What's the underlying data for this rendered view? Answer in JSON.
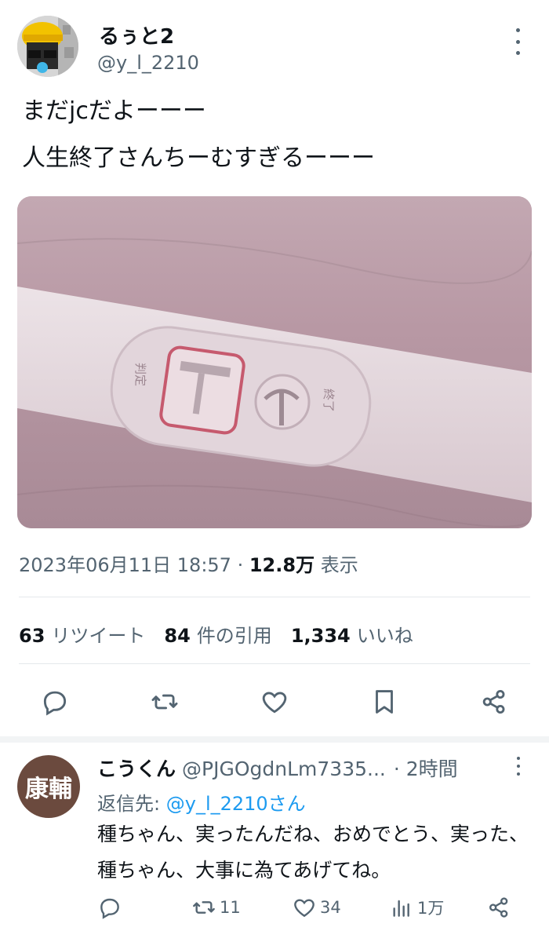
{
  "tweet": {
    "display_name": "るぅと2",
    "handle": "@y_l_2210",
    "text_line1": "まだjcだよーーー",
    "text_line2": "人生終了さんちーむすぎるーーー",
    "date": "2023年06月11日 18:57 ·",
    "views_count": "12.8万",
    "views_label": "表示"
  },
  "stats": {
    "retweets_count": "63",
    "retweets_label": "リツイート",
    "quotes_count": "84",
    "quotes_label": "件の引用",
    "likes_count": "1,334",
    "likes_label": "いいね"
  },
  "photo": {
    "test_label_left": "判定",
    "test_label_right": "終了"
  },
  "actions": [
    "reply-icon",
    "retweet-icon",
    "like-icon",
    "bookmark-icon",
    "share-icon"
  ],
  "reply": {
    "avatar_text": "康輔",
    "display_name": "こうくん",
    "handle": "@PJGOgdnLm7335...",
    "time": "· 2時間",
    "reply_to_prefix": "返信先:",
    "reply_to_handle": "@y_l_2210さん",
    "text": "種ちゃん、実ったんだね、おめでとう、実った、種ちゃん、大事に為てあげてね。",
    "retweets": "11",
    "likes": "34",
    "views": "1万"
  },
  "colors": {
    "accent": "#1d9bf0",
    "secondary_text": "#536471",
    "primary_text": "#0f1419"
  }
}
